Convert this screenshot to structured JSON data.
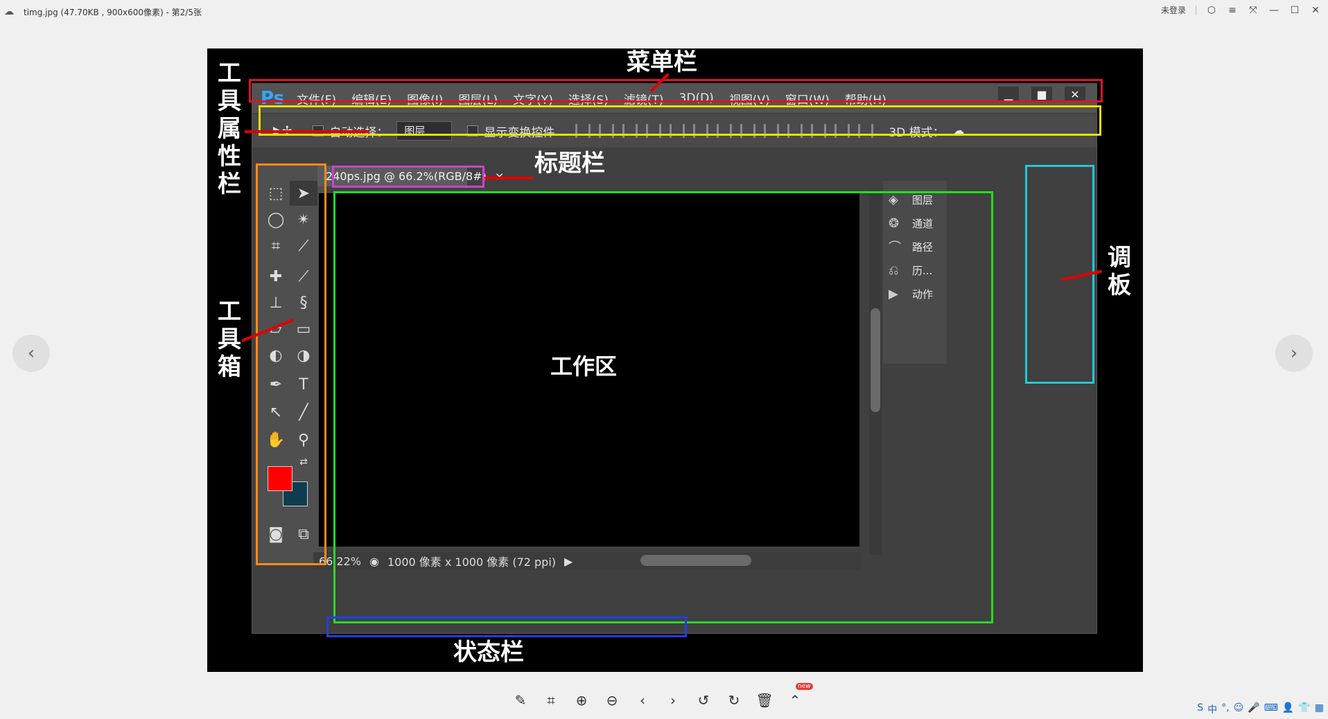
{
  "viewer": {
    "title": "timg.jpg (47.70KB , 900x600像素) - 第2/5张",
    "login_label": "未登录"
  },
  "ps": {
    "logo": "Ps",
    "menus": [
      "文件(F)",
      "编辑(E)",
      "图像(I)",
      "图层(L)",
      "文字(Y)",
      "选择(S)",
      "滤镜(T)",
      "3D(D)",
      "视图(V)",
      "窗口(W)",
      "帮助(H)"
    ],
    "options": {
      "auto_select": "自动选择：",
      "layer_select": "图层",
      "show_transform": "显示变换控件",
      "mode_3d": "3D 模式："
    },
    "doc_tab": "240ps.jpg @ 66.2%(RGB/8#)",
    "doc_tab_close": "×",
    "status": {
      "zoom": "66.22%",
      "size": "1000 像素 x 1000 像素 (72 ppi)"
    },
    "panels": [
      "图层",
      "通道",
      "路径",
      "历...",
      "动作"
    ],
    "fg_color": "#ff0000",
    "bg_color": "#0e3d4f"
  },
  "annotations": {
    "menubar": "菜单栏",
    "options_bar": "工具属性栏",
    "title_bar": "标题栏",
    "toolbox": "工具箱",
    "panel": "调板",
    "work_area": "工作区",
    "status_bar": "状态栏"
  },
  "colors": {
    "menubar_box": "#e0102a",
    "options_box": "#e8e000",
    "toolbox_box": "#ff8c1a",
    "title_box": "#d040d0",
    "canvas_box": "#22dd22",
    "panel_box": "#20c8d8",
    "status_box": "#2040e0"
  }
}
